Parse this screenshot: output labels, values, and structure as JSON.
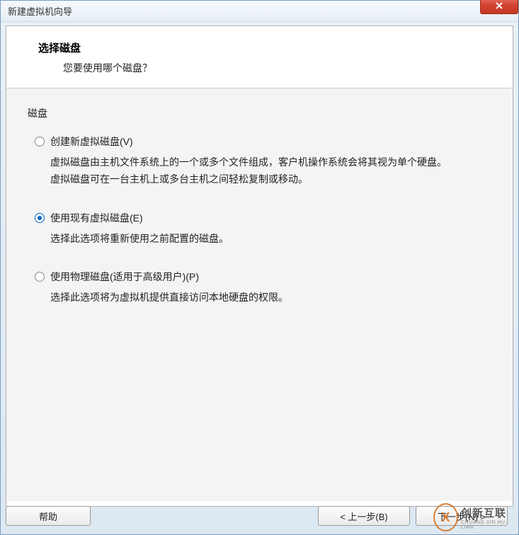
{
  "window": {
    "title": "新建虚拟机向导"
  },
  "header": {
    "title": "选择磁盘",
    "subtitle": "您要使用哪个磁盘？"
  },
  "group": {
    "label": "磁盘"
  },
  "options": [
    {
      "label": "创建新虚拟磁盘(V)",
      "description": "虚拟磁盘由主机文件系统上的一个或多个文件组成，客户机操作系统会将其视为单个硬盘。虚拟磁盘可在一台主机上或多台主机之间轻松复制或移动。",
      "selected": false
    },
    {
      "label": "使用现有虚拟磁盘(E)",
      "description": "选择此选项将重新使用之前配置的磁盘。",
      "selected": true
    },
    {
      "label": "使用物理磁盘(适用于高级用户)(P)",
      "description": "选择此选项将为虚拟机提供直接访问本地硬盘的权限。",
      "selected": false
    }
  ],
  "buttons": {
    "help": "帮助",
    "back": "< 上一步(B)",
    "next": "下一步(N) >"
  },
  "watermark": {
    "logo": "X",
    "cn": "创新互联",
    "en": "CHUANG XIN HU LIAN"
  }
}
